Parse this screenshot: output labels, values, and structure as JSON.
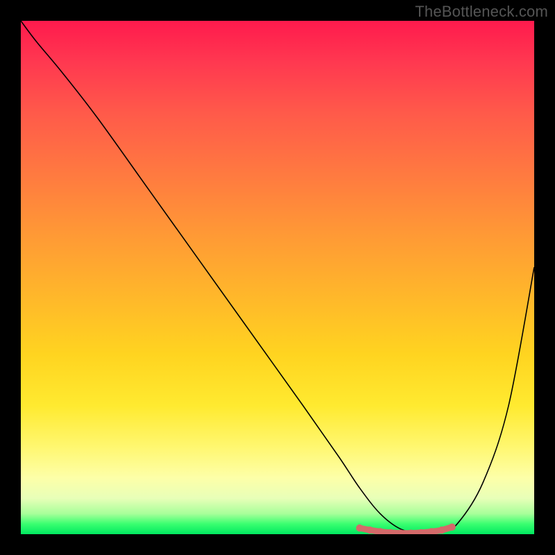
{
  "watermark": "TheBottleneck.com",
  "chart_data": {
    "type": "line",
    "title": "",
    "xlabel": "",
    "ylabel": "",
    "xlim": [
      0,
      100
    ],
    "ylim": [
      0,
      100
    ],
    "series": [
      {
        "name": "curve",
        "x": [
          0,
          3,
          8,
          15,
          25,
          35,
          45,
          55,
          62,
          66,
          70,
          74,
          78,
          82,
          85,
          90,
          95,
          100
        ],
        "values": [
          100,
          96,
          90,
          81,
          67,
          53,
          39,
          25,
          15,
          9,
          4,
          1,
          0.2,
          0.6,
          2,
          10,
          25,
          52
        ]
      },
      {
        "name": "bottom-marker",
        "x": [
          66,
          68,
          70,
          72,
          74,
          76,
          78,
          80,
          82,
          84
        ],
        "values": [
          1.2,
          0.8,
          0.5,
          0.3,
          0.2,
          0.2,
          0.3,
          0.5,
          0.8,
          1.4
        ]
      }
    ],
    "marker_color": "#d46a6a",
    "curve_color": "#000000",
    "gradient_stops": [
      {
        "pos": 0,
        "color": "#ff1a4d"
      },
      {
        "pos": 8,
        "color": "#ff3850"
      },
      {
        "pos": 18,
        "color": "#ff5a4a"
      },
      {
        "pos": 30,
        "color": "#ff7a40"
      },
      {
        "pos": 42,
        "color": "#ff9a35"
      },
      {
        "pos": 54,
        "color": "#ffb82a"
      },
      {
        "pos": 65,
        "color": "#ffd420"
      },
      {
        "pos": 75,
        "color": "#ffea30"
      },
      {
        "pos": 83,
        "color": "#fff770"
      },
      {
        "pos": 89,
        "color": "#fdffa8"
      },
      {
        "pos": 93,
        "color": "#e8ffb8"
      },
      {
        "pos": 96,
        "color": "#a8ff9a"
      },
      {
        "pos": 98,
        "color": "#3aff70"
      },
      {
        "pos": 100,
        "color": "#00e860"
      }
    ]
  }
}
